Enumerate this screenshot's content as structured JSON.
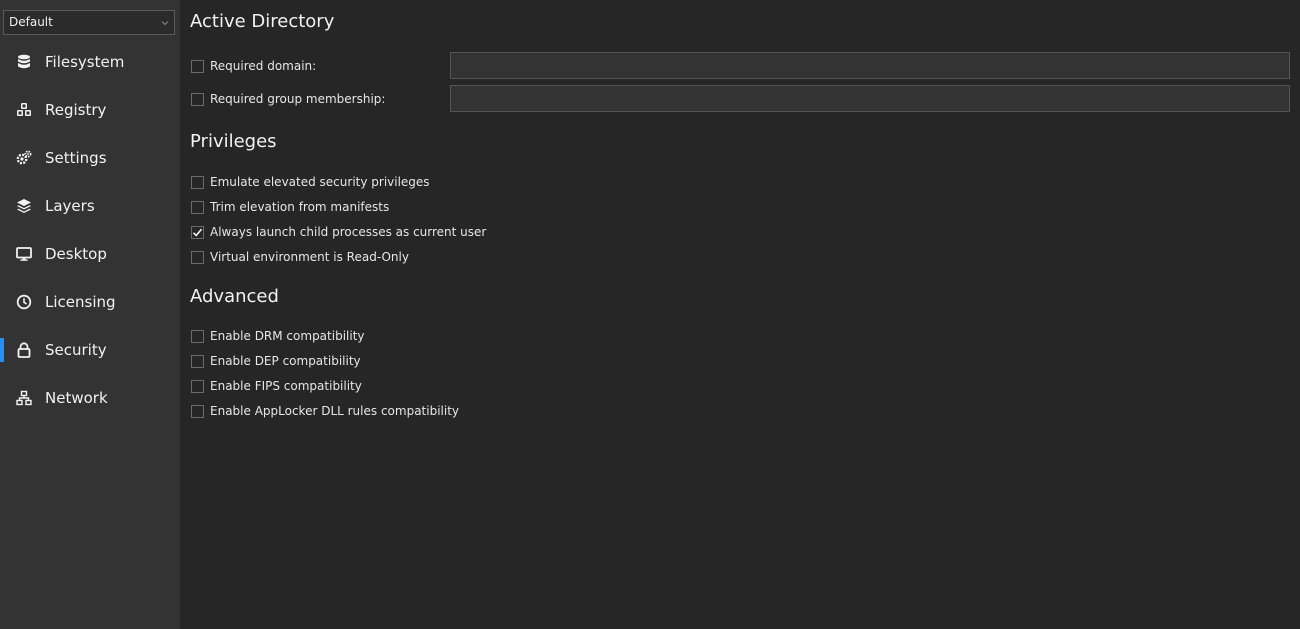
{
  "sidebar": {
    "profile": {
      "selected": "Default"
    },
    "items": [
      {
        "label": "Filesystem",
        "icon": "database-icon"
      },
      {
        "label": "Registry",
        "icon": "cubes-icon"
      },
      {
        "label": "Settings",
        "icon": "gears-icon"
      },
      {
        "label": "Layers",
        "icon": "layers-icon"
      },
      {
        "label": "Desktop",
        "icon": "monitor-icon"
      },
      {
        "label": "Licensing",
        "icon": "clock-icon"
      },
      {
        "label": "Security",
        "icon": "lock-icon",
        "active": true
      },
      {
        "label": "Network",
        "icon": "network-icon"
      }
    ]
  },
  "main": {
    "active_directory": {
      "title": "Active Directory",
      "required_domain": {
        "label": "Required domain:",
        "checked": false,
        "value": ""
      },
      "required_group": {
        "label": "Required group membership:",
        "checked": false,
        "value": ""
      }
    },
    "privileges": {
      "title": "Privileges",
      "options": [
        {
          "label": "Emulate elevated security privileges",
          "checked": false
        },
        {
          "label": "Trim elevation from manifests",
          "checked": false
        },
        {
          "label": "Always launch child processes as current user",
          "checked": true
        },
        {
          "label": "Virtual environment is Read-Only",
          "checked": false
        }
      ]
    },
    "advanced": {
      "title": "Advanced",
      "options": [
        {
          "label": "Enable DRM compatibility",
          "checked": false
        },
        {
          "label": "Enable DEP compatibility",
          "checked": false
        },
        {
          "label": "Enable FIPS compatibility",
          "checked": false
        },
        {
          "label": "Enable AppLocker DLL rules compatibility",
          "checked": false
        }
      ]
    }
  },
  "colors": {
    "accent": "#1e90ff",
    "sidebar_bg": "#333333",
    "main_bg": "#262626"
  }
}
